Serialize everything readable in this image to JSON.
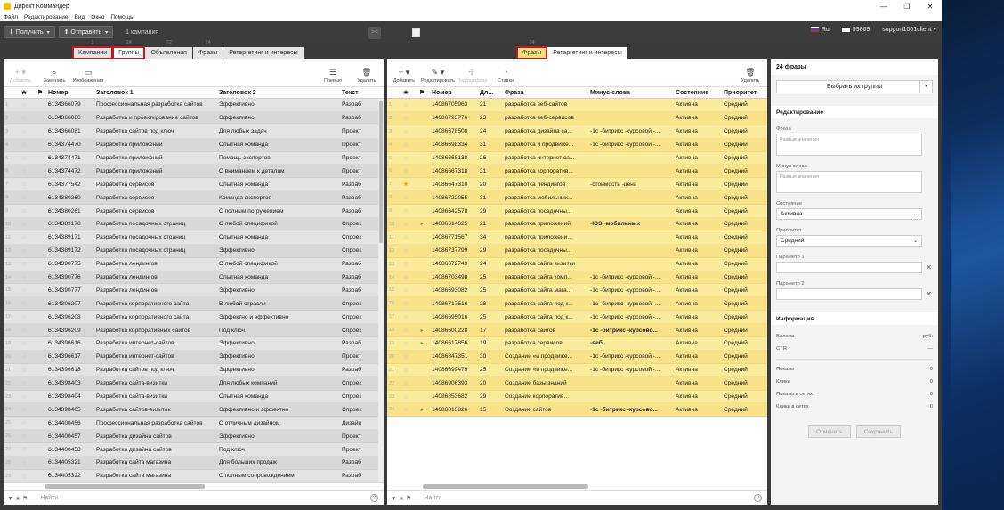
{
  "window": {
    "title": "Директ Коммандер"
  },
  "menu": [
    "Файл",
    "Редактирование",
    "Вид",
    "Окно",
    "Помощь"
  ],
  "toolbar": {
    "get_label": "Получить",
    "send_label": "Отправить",
    "campaign_count": "1 кампания"
  },
  "status": {
    "language": "Ru",
    "balance": "99869",
    "user": "support1001client"
  },
  "left_tabs": [
    {
      "label": "Кампании",
      "count": "1",
      "highlight": true
    },
    {
      "label": "Группы",
      "count": "24",
      "highlight": true,
      "active": true
    },
    {
      "label": "Объявления",
      "count": "72"
    },
    {
      "label": "Фразы",
      "count": "24"
    },
    {
      "label": "Ретаргетинг и интересы",
      "count": ""
    }
  ],
  "right_tabs": [
    {
      "label": "Фразы",
      "count": "24",
      "highlight": true
    },
    {
      "label": "Ретаргетинг и интересы",
      "count": ""
    }
  ],
  "left_tools": {
    "add": "Добавить",
    "replace": "Заменить",
    "images": "Изображения",
    "preview": "Превью",
    "delete": "Удалить"
  },
  "right_tools": {
    "add": "Добавить",
    "edit": "Редактировать",
    "phrase_pick": "Подбор фраз",
    "bids": "Ставки",
    "delete": "Удалить"
  },
  "left_columns": {
    "number": "Номер",
    "title1": "Заголовок 1",
    "title2": "Заголовок 2",
    "text": "Текст"
  },
  "right_columns": {
    "number": "Номер",
    "length": "Дл...",
    "phrase": "Фраза",
    "minus": "Минус-слова",
    "state": "Состояние",
    "priority": "Приоритет"
  },
  "left_rows": [
    {
      "n": "6134366079",
      "t1": "Профессиональная разработка сайтов",
      "t2": "Эффективно!",
      "tx": "Разраб"
    },
    {
      "n": "6134366080",
      "t1": "Разработка и проектирование сайтов",
      "t2": "Эффективно!",
      "tx": "Разраб"
    },
    {
      "n": "6134366081",
      "t1": "Разработка сайтов под ключ",
      "t2": "Для любых задач",
      "tx": "Проект"
    },
    {
      "n": "6134374470",
      "t1": "Разработка приложений",
      "t2": "Опытная команда",
      "tx": "Проект"
    },
    {
      "n": "6134374471",
      "t1": "Разработка приложений",
      "t2": "Помощь экспертов",
      "tx": "Проект"
    },
    {
      "n": "6134374472",
      "t1": "Разработка приложений",
      "t2": "С вниманием к деталям",
      "tx": "Проект"
    },
    {
      "n": "6134377542",
      "t1": "Разработка сервисов",
      "t2": "Опытная команда",
      "tx": "Разраб"
    },
    {
      "n": "6134380260",
      "t1": "Разработка сервисов",
      "t2": "Команда экспертов",
      "tx": "Разраб"
    },
    {
      "n": "6134380261",
      "t1": "Разработка сервисов",
      "t2": "С полным погружением",
      "tx": "Разраб"
    },
    {
      "n": "6134389170",
      "t1": "Разработка посадочных страниц",
      "t2": "С любой спецификой",
      "tx": "Спроек"
    },
    {
      "n": "6134389171",
      "t1": "Разработка посадочных страниц",
      "t2": "Опытная команда",
      "tx": "Спроек"
    },
    {
      "n": "6134389172",
      "t1": "Разработка посадочных страниц",
      "t2": "Эффективно",
      "tx": "Спроек"
    },
    {
      "n": "6134390775",
      "t1": "Разработка лендингов",
      "t2": "С любой спецификой",
      "tx": "Разраб"
    },
    {
      "n": "6134390776",
      "t1": "Разработка лендингов",
      "t2": "Опытная команда",
      "tx": "Разраб"
    },
    {
      "n": "6134390777",
      "t1": "Разработка лендингов",
      "t2": "Эффективно",
      "tx": "Разраб"
    },
    {
      "n": "6134396207",
      "t1": "Разработка корпоративного сайта",
      "t2": "В любой отрасли",
      "tx": "Спроек"
    },
    {
      "n": "6134396208",
      "t1": "Разработка корпоративного сайта",
      "t2": "Эффектно и эффективно",
      "tx": "Спроек"
    },
    {
      "n": "6134396209",
      "t1": "Разработка корпоративных сайтов",
      "t2": "Под ключ",
      "tx": "Спроек"
    },
    {
      "n": "6134396616",
      "t1": "Разработка интернет-сайтов",
      "t2": "Эффективно!",
      "tx": "Разраб"
    },
    {
      "n": "6134396617",
      "t1": "Разработка интернет-сайтов",
      "t2": "Эффективно!",
      "tx": "Проект"
    },
    {
      "n": "6134396618",
      "t1": "Разработка сайтов под ключ",
      "t2": "Эффективно!",
      "tx": "Разраб"
    },
    {
      "n": "6134398403",
      "t1": "Разработка сайта-визитки",
      "t2": "Для любых компаний",
      "tx": "Спроек"
    },
    {
      "n": "6134398404",
      "t1": "Разработка сайта-визитки",
      "t2": "Опытная команда",
      "tx": "Спроек"
    },
    {
      "n": "6134398405",
      "t1": "Разработка сайтов-визиток",
      "t2": "Эффективно и эффектно",
      "tx": "Спроек"
    },
    {
      "n": "6134400456",
      "t1": "Профессиональная разработка сайтов",
      "t2": "С отличным дизайном",
      "tx": "Дизайн"
    },
    {
      "n": "6134400457",
      "t1": "Разработка дизайна сайтов",
      "t2": "Эффективно!",
      "tx": "Проект"
    },
    {
      "n": "6134400458",
      "t1": "Разработка дизайна сайтов",
      "t2": "Под ключ",
      "tx": "Проект"
    },
    {
      "n": "6134405321",
      "t1": "Разработка сайта магазина",
      "t2": "Для больших продаж",
      "tx": "Разраб"
    },
    {
      "n": "6134405322",
      "t1": "Разработка сайта магазина",
      "t2": "С полным сопровождением",
      "tx": "Разраб"
    }
  ],
  "right_rows": [
    {
      "n": "14086705963",
      "l": "21",
      "p": "разработка веб-сайтов",
      "m": "",
      "s": "Активна",
      "pr": "Средний",
      "star": false,
      "flag": false
    },
    {
      "n": "14086793776",
      "l": "23",
      "p": "разработка веб-сервисов",
      "m": "",
      "s": "Активна",
      "pr": "Средний",
      "star": false,
      "flag": false
    },
    {
      "n": "14086678508",
      "l": "24",
      "p": "разработка дизайна са...",
      "m": "-1с -битрикс -курсовой -...",
      "s": "Активна",
      "pr": "Средний",
      "star": false,
      "flag": false
    },
    {
      "n": "14086698334",
      "l": "31",
      "p": "разработка и продвиже...",
      "m": "-1с -битрикс -курсовой -...",
      "s": "Активна",
      "pr": "Средний",
      "star": false,
      "flag": false
    },
    {
      "n": "14086668138",
      "l": "26",
      "p": "разработка интернет са...",
      "m": "",
      "s": "Активна",
      "pr": "Средний",
      "star": false,
      "flag": false
    },
    {
      "n": "14086667318",
      "l": "31",
      "p": "разработка корпоратив...",
      "m": "",
      "s": "Активна",
      "pr": "Средний",
      "star": false,
      "flag": false
    },
    {
      "n": "14086647310",
      "l": "20",
      "p": "разработка лендингов",
      "m": "-стоимость -цена",
      "s": "Активна",
      "pr": "Средний",
      "star": true,
      "flag": false
    },
    {
      "n": "14086722055",
      "l": "31",
      "p": "разработка мобильных...",
      "m": "",
      "s": "Активна",
      "pr": "Средний",
      "star": false,
      "flag": false
    },
    {
      "n": "14086642578",
      "l": "29",
      "p": "разработка посадочны...",
      "m": "",
      "s": "Активна",
      "pr": "Средний",
      "star": false,
      "flag": false
    },
    {
      "n": "14086614625",
      "l": "21",
      "p": "разработка приложений",
      "m": "-IOS -мобильных",
      "s": "Активна",
      "pr": "Средний",
      "star": false,
      "flag": true
    },
    {
      "n": "14086771567",
      "l": "34",
      "p": "разработка приложени...",
      "m": "",
      "s": "Активна",
      "pr": "Средний",
      "star": false,
      "flag": false
    },
    {
      "n": "14086737799",
      "l": "29",
      "p": "разработка посадочны...",
      "m": "",
      "s": "Активна",
      "pr": "Средний",
      "star": false,
      "flag": false
    },
    {
      "n": "14086672749",
      "l": "24",
      "p": "разработка сайта визитки",
      "m": "",
      "s": "Активна",
      "pr": "Средний",
      "star": false,
      "flag": false
    },
    {
      "n": "14086703498",
      "l": "25",
      "p": "разработка сайта комп...",
      "m": "-1с -битрикс -курсовой -...",
      "s": "Активна",
      "pr": "Средний",
      "star": false,
      "flag": false
    },
    {
      "n": "14086693082",
      "l": "25",
      "p": "разработка сайта мага...",
      "m": "-1с -битрикс -курсовой -...",
      "s": "Активна",
      "pr": "Средний",
      "star": false,
      "flag": false
    },
    {
      "n": "14086717516",
      "l": "28",
      "p": "разработка сайта под к...",
      "m": "-1с -битрикс -курсовой -...",
      "s": "Активна",
      "pr": "Средний",
      "star": false,
      "flag": false
    },
    {
      "n": "14086695016",
      "l": "25",
      "p": "разработка сайта под к...",
      "m": "-1с -битрикс -курсовой -...",
      "s": "Активна",
      "pr": "Средний",
      "star": false,
      "flag": false
    },
    {
      "n": "14086600228",
      "l": "17",
      "p": "разработка сайтов",
      "m": "-1с -битрикс -курсово...",
      "s": "Активна",
      "pr": "Средний",
      "star": false,
      "flag": true
    },
    {
      "n": "14086617856",
      "l": "19",
      "p": "разработка сервисов",
      "m": "-веб",
      "s": "Активна",
      "pr": "Средний",
      "star": false,
      "flag": true
    },
    {
      "n": "14086847351",
      "l": "30",
      "p": "Создание «и продвиже...",
      "m": "-1с -битрикс -курсовой -...",
      "s": "Активна",
      "pr": "Средний",
      "star": false,
      "flag": false
    },
    {
      "n": "14086699479",
      "l": "25",
      "p": "Создание «и продвиже...",
      "m": "-1с -битрикс -курсовой -...",
      "s": "Активна",
      "pr": "Средний",
      "star": false,
      "flag": false
    },
    {
      "n": "14086906393",
      "l": "20",
      "p": "Создание базы знаний",
      "m": "",
      "s": "Активна",
      "pr": "Средний",
      "star": false,
      "flag": false
    },
    {
      "n": "14086853682",
      "l": "29",
      "p": "Создание корпоратив...",
      "m": "",
      "s": "Активна",
      "pr": "Средний",
      "star": false,
      "flag": false
    },
    {
      "n": "14086813826",
      "l": "15",
      "p": "Создание сайтов",
      "m": "-1с -битрикс -курсово...",
      "s": "Активна",
      "pr": "Средний",
      "star": false,
      "flag": true
    }
  ],
  "left_search": {
    "placeholder": "Найти"
  },
  "right_search": {
    "placeholder": "Найти"
  },
  "side": {
    "title": "24 фразы",
    "select_groups": "Выбрать их группы",
    "edit_section": "Редактирование",
    "phrase_label": "Фраза",
    "phrase_placeholder": "Разные значения",
    "minus_label": "Минус-слова",
    "minus_placeholder": "Разные значения",
    "state_label": "Состояние",
    "state_value": "Активна",
    "priority_label": "Приоритет",
    "priority_value": "Средний",
    "param1_label": "Параметр 1",
    "param2_label": "Параметр 2",
    "info_section": "Информация",
    "currency_label": "Валюта",
    "currency_value": "руб.",
    "ctr_label": "CTR",
    "ctr_value": "—",
    "shows_label": "Показы",
    "shows_value": "0",
    "clicks_label": "Клики",
    "clicks_value": "0",
    "net_shows_label": "Показы в сетях",
    "net_shows_value": "0",
    "net_clicks_label": "Клики в сетях",
    "net_clicks_value": "0",
    "cancel_label": "Отменить",
    "save_label": "Сохранить"
  }
}
